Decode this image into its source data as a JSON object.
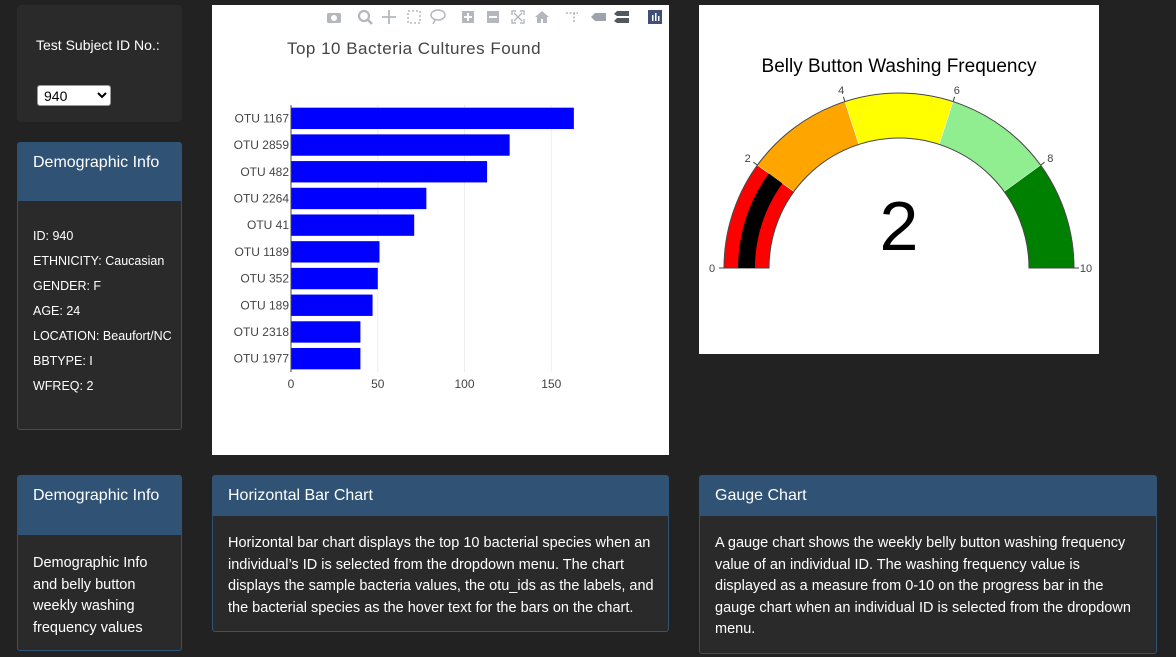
{
  "selector": {
    "label": "Test Subject ID No.:",
    "selected": "940"
  },
  "demographics": {
    "title": "Demographic Info",
    "items": [
      "ID: 940",
      "ETHNICITY: Caucasian",
      "GENDER: F",
      "AGE: 24",
      "LOCATION: Beaufort/NC",
      "BBTYPE: I",
      "WFREQ: 2"
    ]
  },
  "toolbar": {
    "icons": [
      "camera-icon",
      "zoom-icon",
      "pan-icon",
      "box-select-icon",
      "lasso-icon",
      "zoom-in-icon",
      "zoom-out-icon",
      "autoscale-icon",
      "home-icon",
      "spike-lines-icon",
      "hover-closest-icon",
      "hover-compare-icon",
      "plotly-logo-icon"
    ]
  },
  "chart_data": [
    {
      "type": "bar",
      "orientation": "horizontal",
      "title": "Top 10 Bacteria Cultures Found",
      "categories": [
        "OTU 1167",
        "OTU 2859",
        "OTU 482",
        "OTU 2264",
        "OTU 41",
        "OTU 1189",
        "OTU 352",
        "OTU 189",
        "OTU 2318",
        "OTU 1977"
      ],
      "values": [
        163,
        126,
        113,
        78,
        71,
        51,
        50,
        47,
        40,
        40
      ],
      "xticks": [
        "0",
        "50",
        "100",
        "150"
      ],
      "xlim": [
        0,
        170
      ],
      "bar_color": "#0000ff",
      "grid": true
    },
    {
      "type": "gauge",
      "title": "Belly Button Washing Frequency",
      "value": 2,
      "value_label": "2",
      "range": [
        0,
        10
      ],
      "ticks": [
        "0",
        "2",
        "4",
        "6",
        "8",
        "10"
      ],
      "bands": [
        {
          "from": 0,
          "to": 2,
          "color": "#ff0000"
        },
        {
          "from": 2,
          "to": 4,
          "color": "#ffa500"
        },
        {
          "from": 4,
          "to": 6,
          "color": "#ffff00"
        },
        {
          "from": 6,
          "to": 8,
          "color": "#90ee90"
        },
        {
          "from": 8,
          "to": 10,
          "color": "#008000"
        }
      ],
      "bar_color": "#000000"
    }
  ],
  "demo_info": {
    "title": "Demographic Info",
    "text": "Demographic Info and belly button weekly washing frequency values"
  },
  "bar_info": {
    "title": "Horizontal Bar Chart",
    "text": "Horizontal bar chart displays the top 10 bacterial species when an individual’s ID is selected from the dropdown menu. The chart displays the sample bacteria values, the otu_ids as the labels, and the bacterial species as the hover text for the bars on the chart."
  },
  "gauge_info": {
    "title": "Gauge Chart",
    "text": "A gauge chart shows the weekly belly button washing frequency value of an individual ID. The washing frequency value is displayed as a measure from 0-10 on the progress bar in the gauge chart when an individual ID is selected from the dropdown menu."
  }
}
